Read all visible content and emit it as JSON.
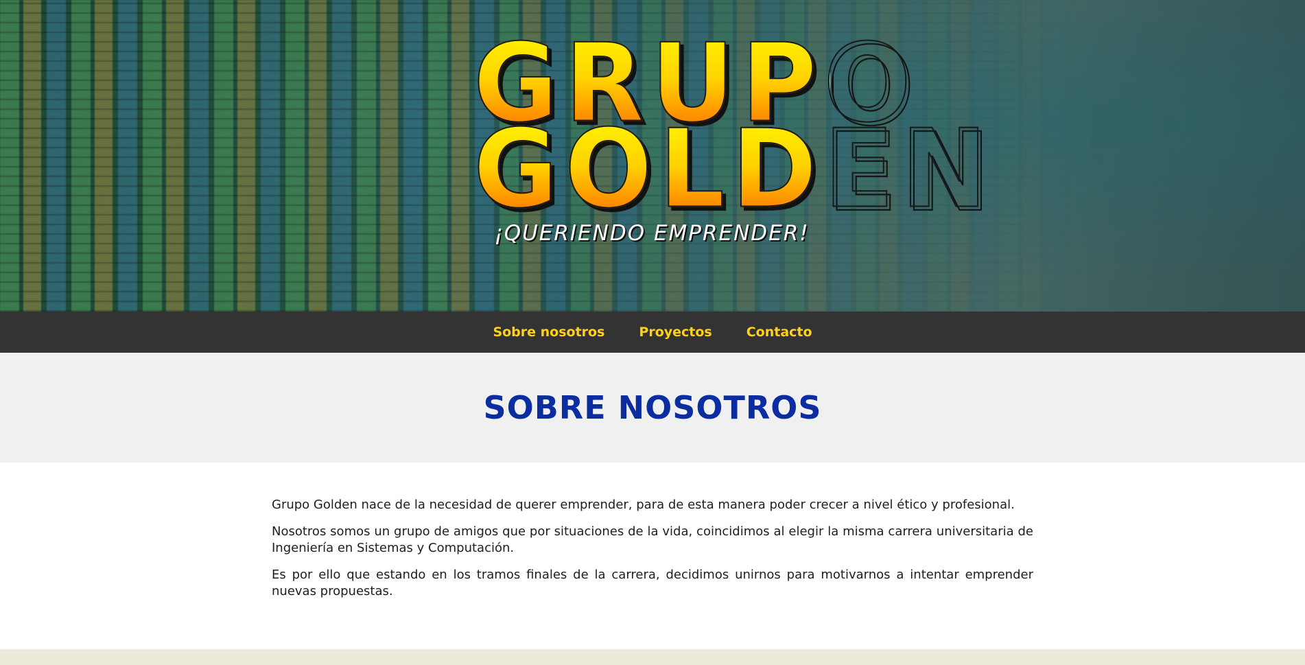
{
  "hero": {
    "logo_line1": "GRUPO",
    "logo_line2": "GOLDEN",
    "tagline": "¡QUERIENDO EMPRENDER!"
  },
  "nav": {
    "items": [
      {
        "label": "Sobre nosotros"
      },
      {
        "label": "Proyectos"
      },
      {
        "label": "Contacto"
      }
    ]
  },
  "section": {
    "title": "SOBRE NOSOTROS",
    "paragraphs": [
      "Grupo Golden nace de la necesidad de querer emprender, para de esta manera poder crecer a nivel ético y profesional.",
      "Nosotros somos un grupo de amigos que por situaciones de la vida, coincidimos al elegir la misma carrera universitaria de Ingeniería en Sistemas y Computación.",
      "Es por ello que estando en los tramos finales de la carrera, decidimos unirnos para motivarnos a intentar emprender nuevas propuestas."
    ]
  },
  "colors": {
    "nav_bg": "#333333",
    "nav_link": "#ffd21a",
    "title": "#0c2da0",
    "section_bg": "#f0f0f0",
    "footer_bg": "#eceadb"
  }
}
